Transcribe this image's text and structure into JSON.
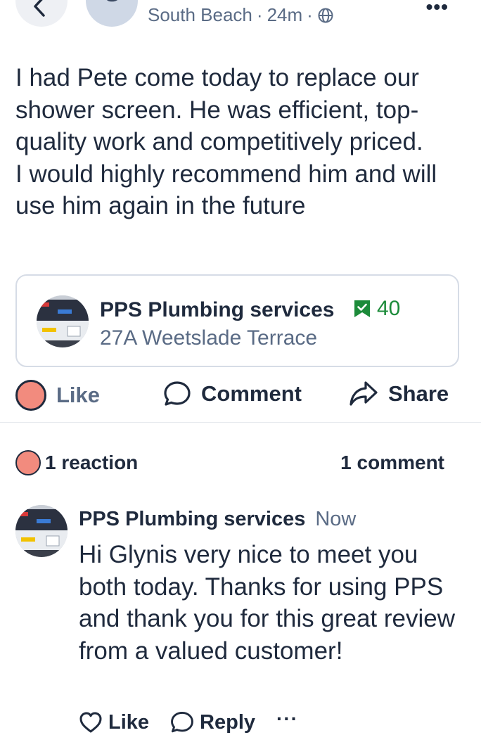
{
  "header": {
    "avatar_initial": "G",
    "location": "South Beach",
    "separator": "·",
    "time": "24m"
  },
  "post": {
    "text": "I had Pete come today to replace our shower screen. He was efficient, top-quality work and competitively priced.\nI would highly recommend him and will use him again in the future"
  },
  "business": {
    "name": "PPS Plumbing services",
    "recommendations": "40",
    "address": "27A Weetslade Terrace"
  },
  "actions": {
    "like": "Like",
    "comment": "Comment",
    "share": "Share"
  },
  "summary": {
    "reactions": "1 reaction",
    "comments": "1 comment"
  },
  "comment": {
    "author": "PPS Plumbing services",
    "time": "Now",
    "text": "Hi Glynis very nice to meet you both today. Thanks for using PPS and thank you for this great review from a valued customer!",
    "like": "Like",
    "reply": "Reply",
    "more": "···"
  },
  "colors": {
    "text": "#1f2a3d",
    "muted": "#5a6b85",
    "heart": "#f28b7e",
    "badge_green": "#1c8b3a"
  }
}
